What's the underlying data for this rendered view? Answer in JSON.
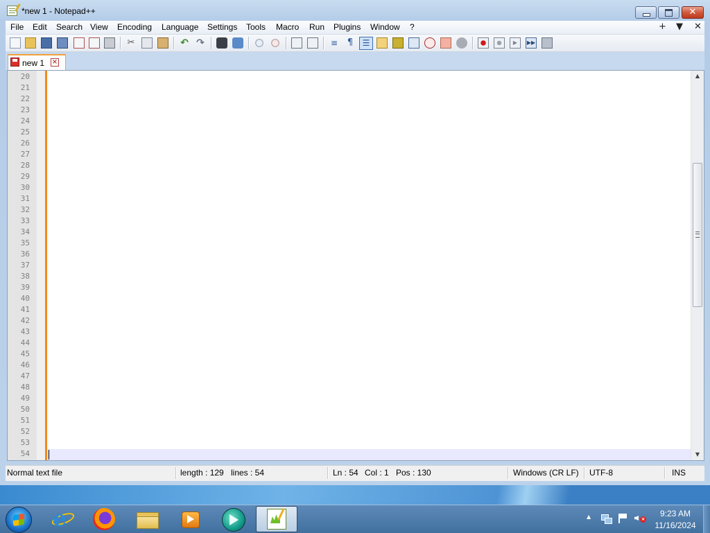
{
  "window": {
    "title": "*new 1 - Notepad++",
    "close_glyph": "✕"
  },
  "menu": {
    "items": [
      "File",
      "Edit",
      "Search",
      "View",
      "Encoding",
      "Language",
      "Settings",
      "Tools",
      "Macro",
      "Run",
      "Plugins",
      "Window",
      "?"
    ],
    "right_controls": [
      "+",
      "▼",
      "✕"
    ]
  },
  "toolbar": {
    "buttons": [
      "new-file",
      "open-file",
      "save",
      "save-all",
      "close",
      "close-all",
      "print",
      "cut",
      "copy",
      "paste",
      "undo",
      "redo",
      "find",
      "replace",
      "zoom-in",
      "zoom-out",
      "sync-vertical",
      "sync-horizontal",
      "word-wrap",
      "show-all-characters",
      "indent-guide",
      "user-defined-language",
      "document-map",
      "function-list",
      "folder-as-workspace",
      "monitoring",
      "record-macro",
      "stop-recording",
      "playback-macro",
      "run-macro-multiple",
      "save-macro"
    ]
  },
  "tabs": [
    {
      "label": "new 1",
      "close_glyph": "×",
      "modified": true
    }
  ],
  "editor": {
    "line_numbers": [
      "20",
      "21",
      "22",
      "23",
      "24",
      "25",
      "26",
      "27",
      "28",
      "29",
      "30",
      "31",
      "32",
      "33",
      "34",
      "35",
      "36",
      "37",
      "38",
      "39",
      "40",
      "41",
      "42",
      "43",
      "44",
      "45",
      "46",
      "47",
      "48",
      "49",
      "50",
      "51",
      "52",
      "53",
      "54"
    ],
    "current_line": "54",
    "scroll_up_glyph": "▲",
    "scroll_down_glyph": "▼"
  },
  "status": {
    "file_type": "Normal text file",
    "length": "length : 129",
    "lines": "lines : 54",
    "ln": "Ln : 54",
    "col": "Col : 1",
    "pos": "Pos : 130",
    "eol": "Windows (CR LF)",
    "encoding": "UTF-8",
    "mode": "INS"
  },
  "taskbar": {
    "apps": [
      "start-button",
      "internet-explorer",
      "firefox",
      "file-explorer",
      "media-player",
      "arrow-app",
      "notepad-plus-plus"
    ],
    "tray_arrow": "▲",
    "time": "9:23 AM",
    "date": "11/16/2024",
    "volume_glyph": "×"
  },
  "colors": {
    "change_bar": "#f28a1c",
    "current_line": "#e8e8ff",
    "taskbar": "#41709f"
  }
}
